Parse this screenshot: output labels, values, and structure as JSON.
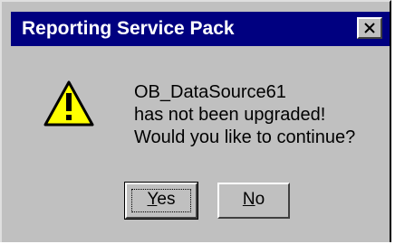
{
  "dialog": {
    "title": "Reporting Service Pack",
    "close_icon": "close-icon",
    "icon": "warning-icon",
    "message_lines": [
      "OB_DataSource61",
      "has not been upgraded!",
      "Would you like to continue?"
    ],
    "buttons": {
      "yes": {
        "accel": "Y",
        "rest": "es"
      },
      "no": {
        "accel": "N",
        "rest": "o"
      }
    }
  },
  "colors": {
    "titlebar": "#000080",
    "face": "#c0c0c0",
    "warning": "#ffff00"
  }
}
